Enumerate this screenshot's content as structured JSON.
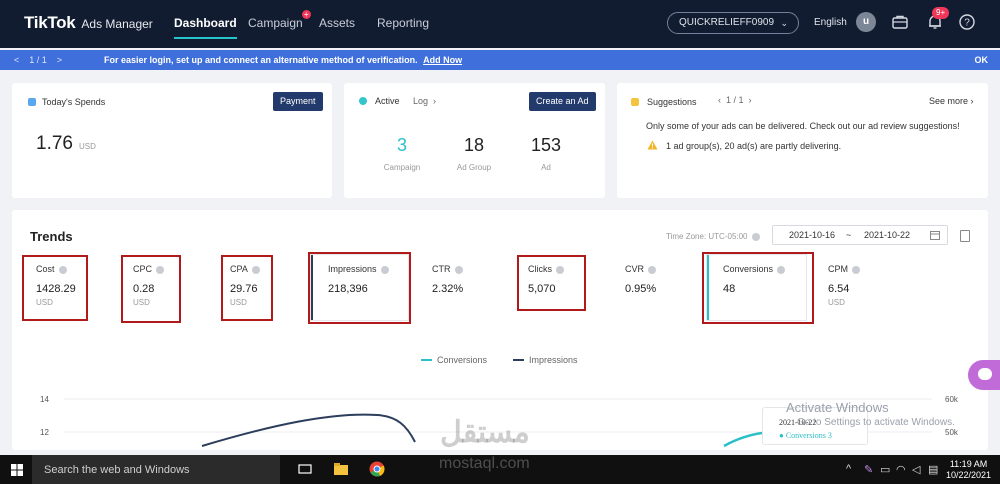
{
  "nav": {
    "logo": "TikTok",
    "logo_sub": "Ads Manager",
    "items": [
      {
        "label": "Dashboard"
      },
      {
        "label": "Campaign"
      },
      {
        "label": "Assets"
      },
      {
        "label": "Reporting"
      }
    ],
    "account": "QUICKRELIEFF0909",
    "language": "English",
    "avatar_letter": "u",
    "notif_badge": "9+",
    "icons": [
      "briefcase-icon",
      "bell-icon",
      "help-icon"
    ]
  },
  "banner": {
    "pager": "1 / 1",
    "message": "For easier login, set up and connect an alternative method of verification.",
    "link": "Add Now",
    "ok": "OK"
  },
  "spend": {
    "label": "Today's Spends",
    "button": "Payment",
    "value": "1.76",
    "unit": "USD"
  },
  "active": {
    "label": "Active",
    "log": "Log",
    "button": "Create an Ad",
    "stats": [
      {
        "value": "3",
        "label": "Campaign"
      },
      {
        "value": "18",
        "label": "Ad Group"
      },
      {
        "value": "153",
        "label": "Ad"
      }
    ]
  },
  "suggestions": {
    "label": "Suggestions",
    "pager": "1 / 1",
    "see_more": "See more",
    "text": "Only some of your ads can be delivered. Check out our ad review suggestions!",
    "warning": "1 ad group(s), 20 ad(s) are partly delivering."
  },
  "trends": {
    "title": "Trends",
    "timezone": "Time Zone: UTC-05:00",
    "date_start": "2021-10-16",
    "date_sep": "~",
    "date_end": "2021-10-22",
    "metrics": [
      {
        "name": "Cost",
        "value": "1428.29",
        "unit": "USD"
      },
      {
        "name": "CPC",
        "value": "0.28",
        "unit": "USD"
      },
      {
        "name": "CPA",
        "value": "29.76",
        "unit": "USD"
      },
      {
        "name": "Impressions",
        "value": "218,396",
        "unit": ""
      },
      {
        "name": "CTR",
        "value": "2.32%",
        "unit": ""
      },
      {
        "name": "Clicks",
        "value": "5,070",
        "unit": ""
      },
      {
        "name": "CVR",
        "value": "0.95%",
        "unit": ""
      },
      {
        "name": "Conversions",
        "value": "48",
        "unit": ""
      },
      {
        "name": "CPM",
        "value": "6.54",
        "unit": "USD"
      }
    ],
    "legend": [
      {
        "name": "Conversions",
        "color": "#2bbfc7"
      },
      {
        "name": "Impressions",
        "color": "#2c3e5c"
      }
    ],
    "y_left": [
      "14",
      "12"
    ],
    "y_right": [
      "60k",
      "50k"
    ],
    "tooltip_date": "2021-10-22",
    "tooltip_value": "Conversions 3"
  },
  "overlay": {
    "activate_title": "Activate Windows",
    "activate_sub": "Go to Settings to activate Windows.",
    "watermark": "مستقل",
    "watermark_sub": "mostaql.com"
  },
  "taskbar": {
    "search": "Search the web and Windows",
    "time": "11:19 AM",
    "date": "10/22/2021"
  }
}
